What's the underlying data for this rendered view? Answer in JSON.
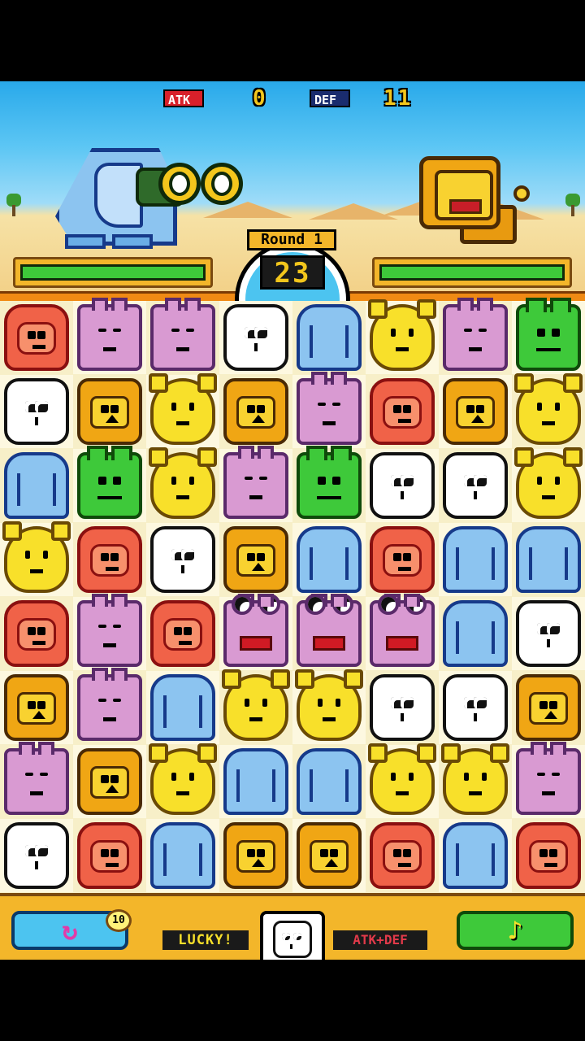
{
  "hud": {
    "atk_label": "ATK",
    "atk_value": "0",
    "def_label": "DEF",
    "def_value": "11",
    "round_label": "Round 1",
    "timer": "23",
    "player_hp_fraction": 1.0,
    "enemy_hp_fraction": 1.0
  },
  "board": {
    "rows": 8,
    "cols": 8,
    "tiles": [
      [
        "monkey",
        "hippo",
        "hippo",
        "panda",
        "elephant",
        "giraffe",
        "hippo",
        "frog"
      ],
      [
        "panda",
        "lion",
        "giraffe",
        "lion",
        "hippo",
        "monkey",
        "lion",
        "giraffe"
      ],
      [
        "elephant",
        "frog",
        "giraffe",
        "hippo",
        "frog",
        "panda",
        "panda",
        "giraffe"
      ],
      [
        "giraffe",
        "monkey",
        "panda",
        "lion",
        "elephant",
        "monkey",
        "elephant",
        "elephant"
      ],
      [
        "monkey",
        "hippo",
        "monkey",
        "hippo-special",
        "hippo-special",
        "hippo-special",
        "elephant",
        "panda"
      ],
      [
        "lion",
        "hippo",
        "elephant",
        "giraffe",
        "giraffe",
        "panda",
        "panda",
        "lion"
      ],
      [
        "hippo",
        "lion",
        "giraffe",
        "elephant",
        "elephant",
        "giraffe",
        "giraffe",
        "hippo"
      ],
      [
        "panda",
        "monkey",
        "elephant",
        "lion",
        "lion",
        "monkey",
        "elephant",
        "monkey"
      ]
    ]
  },
  "bottom_bar": {
    "shuffle_icon": "↻",
    "shuffle_count": "10",
    "lucky_label": "LUCKY!",
    "lucky_animal": "panda",
    "lucky_bonus": "ATK+DEF",
    "music_icon": "♪"
  },
  "colors": {
    "sky": "#29a9ea",
    "sand": "#f2cf85",
    "hp_green": "#3ec93a",
    "frame_orange": "#f3b62a"
  }
}
